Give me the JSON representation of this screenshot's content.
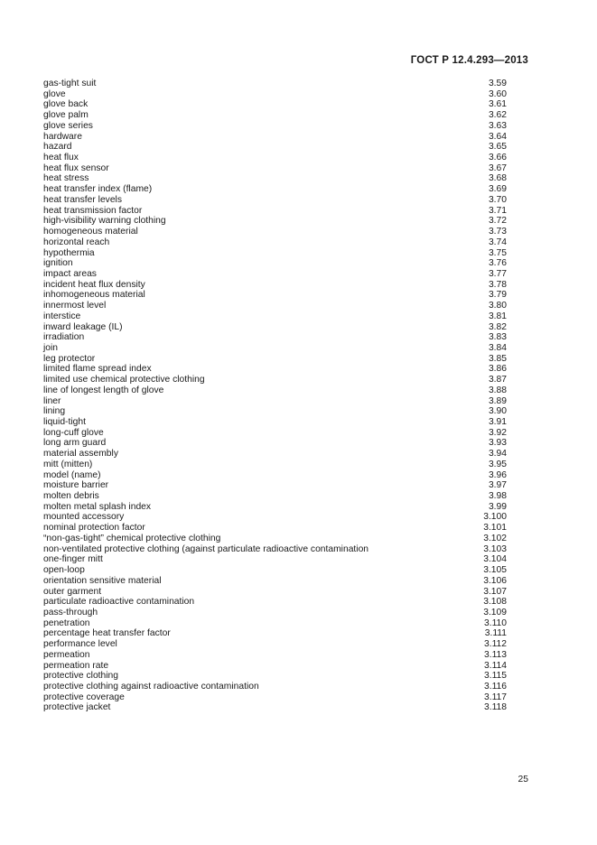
{
  "header": {
    "standard_title": "ГОСТ Р 12.4.293—2013"
  },
  "footer": {
    "page_number": "25"
  },
  "index": {
    "entries": [
      {
        "term": "gas-tight suit",
        "number": "3.59"
      },
      {
        "term": "glove",
        "number": "3.60"
      },
      {
        "term": "glove back",
        "number": "3.61"
      },
      {
        "term": "glove palm",
        "number": "3.62"
      },
      {
        "term": "glove series",
        "number": "3.63"
      },
      {
        "term": "hardware",
        "number": "3.64"
      },
      {
        "term": "hazard",
        "number": "3.65"
      },
      {
        "term": "heat flux",
        "number": "3.66"
      },
      {
        "term": "heat flux sensor",
        "number": "3.67"
      },
      {
        "term": "heat stress",
        "number": "3.68"
      },
      {
        "term": "heat transfer index (flame)",
        "number": "3.69"
      },
      {
        "term": "heat transfer levels",
        "number": "3.70"
      },
      {
        "term": "heat transmission factor",
        "number": "3.71"
      },
      {
        "term": "high-visibility warning clothing",
        "number": "3.72"
      },
      {
        "term": "homogeneous material",
        "number": "3.73"
      },
      {
        "term": "horizontal reach",
        "number": "3.74"
      },
      {
        "term": "hypothermia",
        "number": "3.75"
      },
      {
        "term": "ignition",
        "number": "3.76"
      },
      {
        "term": "impact areas",
        "number": "3.77"
      },
      {
        "term": "incident heat flux density",
        "number": "3.78"
      },
      {
        "term": "inhomogeneous material",
        "number": "3.79"
      },
      {
        "term": "innermost level",
        "number": "3.80"
      },
      {
        "term": "interstice",
        "number": "3.81"
      },
      {
        "term": "inward leakage (IL)",
        "number": "3.82"
      },
      {
        "term": "irradiation",
        "number": "3.83"
      },
      {
        "term": "join",
        "number": "3.84"
      },
      {
        "term": "leg protector",
        "number": "3.85"
      },
      {
        "term": "limited flame spread index",
        "number": "3.86"
      },
      {
        "term": "limited use chemical protective clothing",
        "number": "3.87"
      },
      {
        "term": "line of longest length of glove",
        "number": "3.88"
      },
      {
        "term": "liner",
        "number": "3.89"
      },
      {
        "term": "lining",
        "number": "3.90"
      },
      {
        "term": "liquid-tight",
        "number": "3.91"
      },
      {
        "term": "long-cuff glove",
        "number": "3.92"
      },
      {
        "term": "long arm guard",
        "number": "3.93"
      },
      {
        "term": "material assembly",
        "number": "3.94"
      },
      {
        "term": "mitt (mitten)",
        "number": "3.95"
      },
      {
        "term": "model (name)",
        "number": "3.96"
      },
      {
        "term": "moisture barrier",
        "number": "3.97"
      },
      {
        "term": "molten debris",
        "number": "3.98"
      },
      {
        "term": "molten metal splash index",
        "number": "3.99"
      },
      {
        "term": "mounted accessory",
        "number": "3.100"
      },
      {
        "term": "nominal protection factor",
        "number": "3.101"
      },
      {
        "term": "“non-gas-tight” chemical protective clothing",
        "number": "3.102"
      },
      {
        "term": "non-ventilated protective clothing (against particulate radioactive contamination",
        "number": "3.103"
      },
      {
        "term": "one-finger mitt",
        "number": "3.104"
      },
      {
        "term": "open-loop",
        "number": "3.105"
      },
      {
        "term": "orientation sensitive material",
        "number": "3.106"
      },
      {
        "term": "outer garment",
        "number": "3.107"
      },
      {
        "term": "particulate radioactive contamination",
        "number": "3.108"
      },
      {
        "term": "pass-through",
        "number": "3.109"
      },
      {
        "term": "penetration",
        "number": "3.110"
      },
      {
        "term": "percentage heat transfer factor",
        "number": "3.111"
      },
      {
        "term": "performance level",
        "number": "3.112"
      },
      {
        "term": "permeation",
        "number": "3.113"
      },
      {
        "term": "permeation rate",
        "number": "3.114"
      },
      {
        "term": "protective clothing",
        "number": "3.115"
      },
      {
        "term": "protective clothing against radioactive contamination",
        "number": "3.116"
      },
      {
        "term": "protective coverage",
        "number": "3.117"
      },
      {
        "term": "protective jacket",
        "number": "3.118"
      }
    ]
  }
}
